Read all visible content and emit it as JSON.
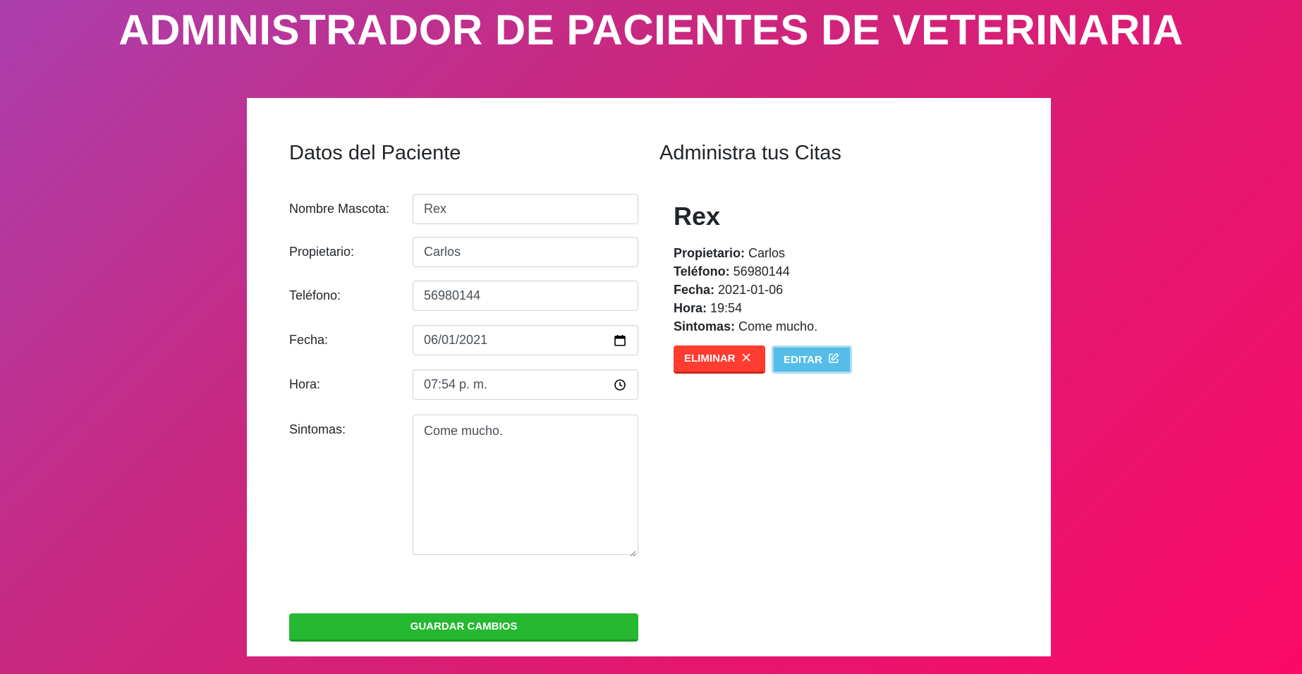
{
  "header": {
    "title": "ADMINISTRADOR DE PACIENTES DE VETERINARIA"
  },
  "form": {
    "title": "Datos del Paciente",
    "fields": [
      {
        "label": "Nombre Mascota:",
        "value": "Rex"
      },
      {
        "label": "Propietario:",
        "value": "Carlos"
      },
      {
        "label": "Teléfono:",
        "value": "56980144"
      },
      {
        "label": "Fecha:",
        "value": "06/01/2021",
        "icon": "calendar-icon"
      },
      {
        "label": "Hora:",
        "value": "07:54 p. m.",
        "icon": "clock-icon"
      },
      {
        "label": "Sintomas:",
        "value": "Come mucho."
      }
    ],
    "submit_label": "GUARDAR CAMBIOS"
  },
  "citas": {
    "title": "Administra tus Citas",
    "items": [
      {
        "name": "Rex",
        "owner_label": "Propietario:",
        "owner": "Carlos",
        "phone_label": "Teléfono:",
        "phone": "56980144",
        "date_label": "Fecha:",
        "date": "2021-01-06",
        "time_label": "Hora:",
        "time": "19:54",
        "symptoms_label": "Sintomas:",
        "symptoms": "Come mucho.",
        "delete_label": "ELIMINAR",
        "delete_icon": "x-icon",
        "edit_label": "EDITAR",
        "edit_icon": "edit-icon"
      }
    ]
  },
  "colors": {
    "save": "#25b830",
    "delete": "#fe3c30",
    "edit": "#55bde8",
    "background_start": "#ab3fad",
    "background_end": "#fb0a67"
  }
}
